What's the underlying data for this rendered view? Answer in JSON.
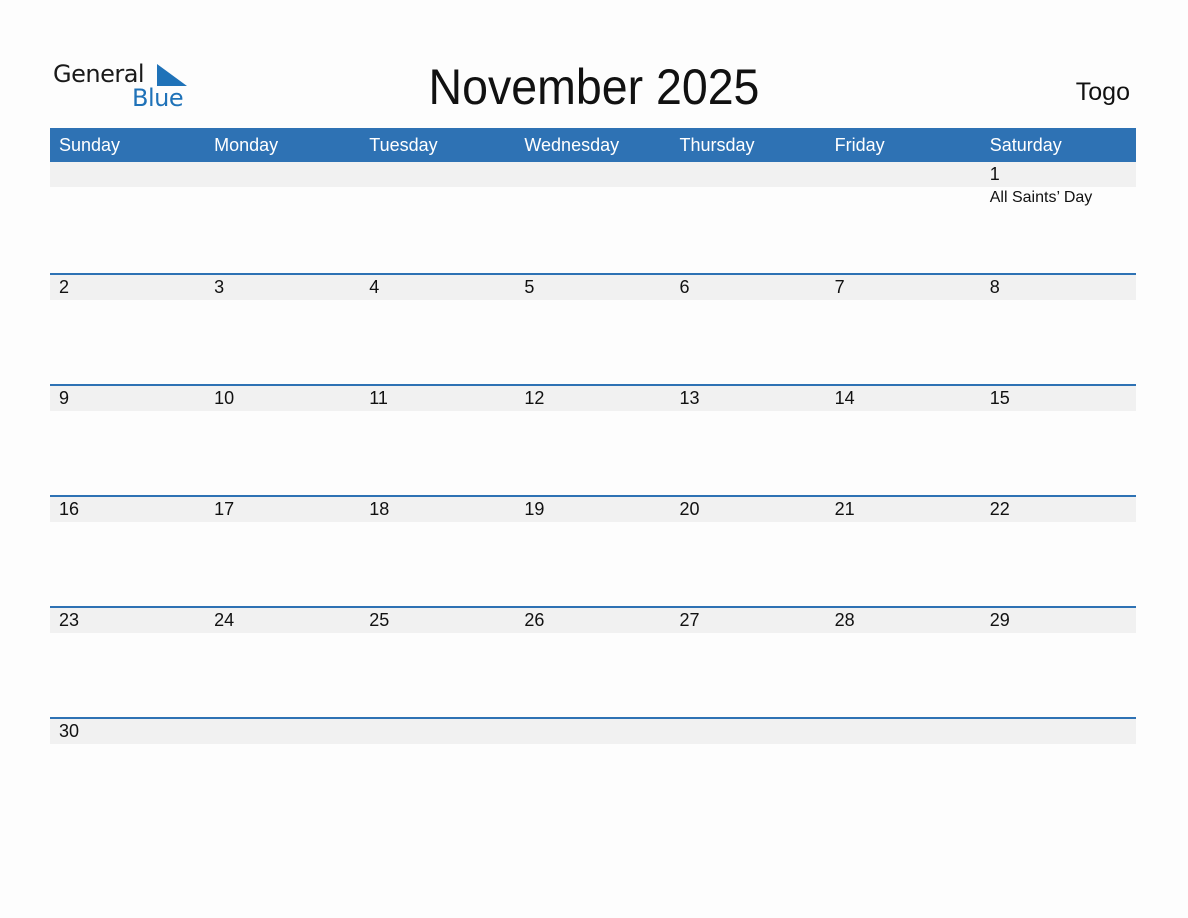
{
  "brand": {
    "line1": "General",
    "line2": "Blue"
  },
  "title": "November 2025",
  "country": "Togo",
  "colors": {
    "accent": "#2e72b4",
    "strip": "#f1f1f1",
    "logo_blue": "#1f72b8"
  },
  "weekdays": [
    "Sunday",
    "Monday",
    "Tuesday",
    "Wednesday",
    "Thursday",
    "Friday",
    "Saturday"
  ],
  "weeks": [
    [
      {
        "day": ""
      },
      {
        "day": ""
      },
      {
        "day": ""
      },
      {
        "day": ""
      },
      {
        "day": ""
      },
      {
        "day": ""
      },
      {
        "day": "1",
        "holiday": "All Saints’ Day"
      }
    ],
    [
      {
        "day": "2"
      },
      {
        "day": "3"
      },
      {
        "day": "4"
      },
      {
        "day": "5"
      },
      {
        "day": "6"
      },
      {
        "day": "7"
      },
      {
        "day": "8"
      }
    ],
    [
      {
        "day": "9"
      },
      {
        "day": "10"
      },
      {
        "day": "11"
      },
      {
        "day": "12"
      },
      {
        "day": "13"
      },
      {
        "day": "14"
      },
      {
        "day": "15"
      }
    ],
    [
      {
        "day": "16"
      },
      {
        "day": "17"
      },
      {
        "day": "18"
      },
      {
        "day": "19"
      },
      {
        "day": "20"
      },
      {
        "day": "21"
      },
      {
        "day": "22"
      }
    ],
    [
      {
        "day": "23"
      },
      {
        "day": "24"
      },
      {
        "day": "25"
      },
      {
        "day": "26"
      },
      {
        "day": "27"
      },
      {
        "day": "28"
      },
      {
        "day": "29"
      }
    ],
    [
      {
        "day": "30"
      },
      {
        "day": ""
      },
      {
        "day": ""
      },
      {
        "day": ""
      },
      {
        "day": ""
      },
      {
        "day": ""
      },
      {
        "day": ""
      }
    ]
  ]
}
